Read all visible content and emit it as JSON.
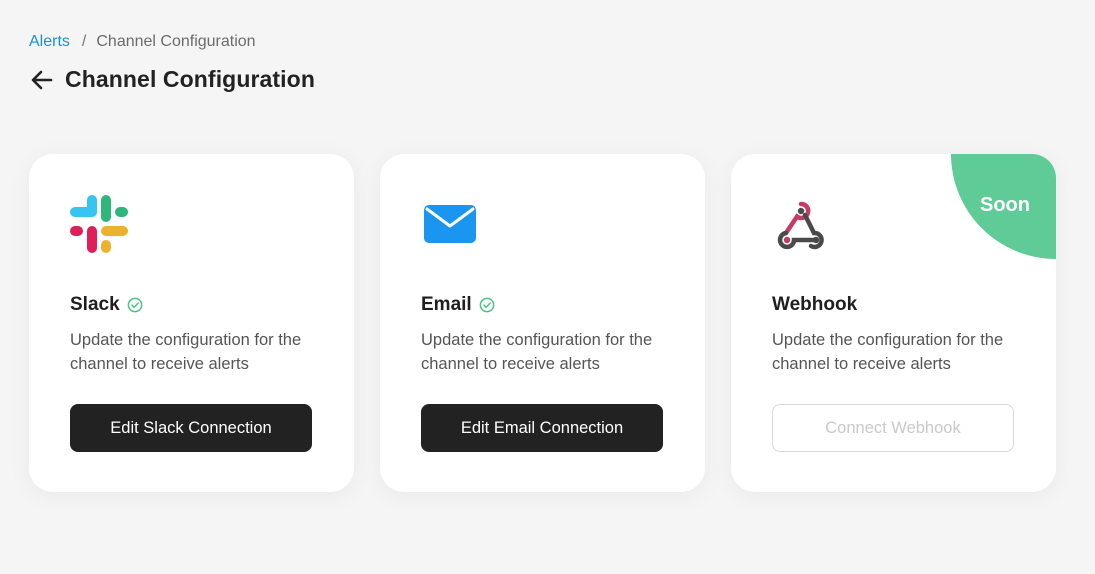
{
  "breadcrumb": {
    "parent": "Alerts",
    "separator": "/",
    "current": "Channel Configuration"
  },
  "page": {
    "title": "Channel Configuration",
    "back_icon": "arrow-left-icon"
  },
  "cards": [
    {
      "name": "Slack",
      "icon": "slack-logo-icon",
      "connected": true,
      "description": "Update the configuration for the channel to receive alerts",
      "button_label": "Edit Slack Connection",
      "button_enabled": true
    },
    {
      "name": "Email",
      "icon": "envelope-icon",
      "connected": true,
      "description": "Update the configuration for the channel to receive alerts",
      "button_label": "Edit Email Connection",
      "button_enabled": true
    },
    {
      "name": "Webhook",
      "icon": "webhook-icon",
      "connected": false,
      "description": "Update the configuration for the channel to receive alerts",
      "button_label": "Connect Webhook",
      "button_enabled": false,
      "badge": "Soon"
    }
  ],
  "colors": {
    "link": "#1a8fd8",
    "check": "#4cc38a",
    "soon_badge": "#5fcb97",
    "button_dark": "#222222",
    "email_blue": "#1a96f0"
  }
}
